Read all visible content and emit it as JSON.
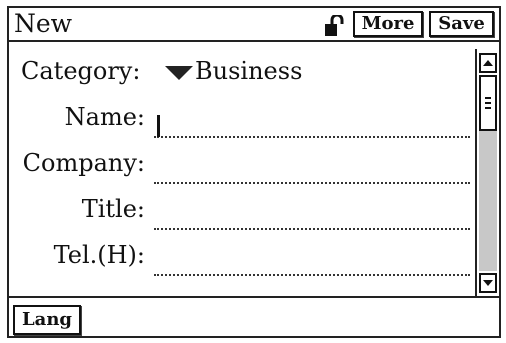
{
  "window": {
    "title": "New"
  },
  "toolbar": {
    "lock_icon": "unlocked-padlock-icon",
    "more_label": "More",
    "save_label": "Save"
  },
  "form": {
    "category_label": "Category:",
    "category_value": "Business",
    "category_dropdown_icon": "triangle-down-icon",
    "fields": [
      {
        "label": "Name:",
        "value": "",
        "focused": true
      },
      {
        "label": "Company:",
        "value": ""
      },
      {
        "label": "Title:",
        "value": ""
      },
      {
        "label": "Tel.(H):",
        "value": ""
      }
    ]
  },
  "scrollbar": {
    "up_icon": "arrow-up-icon",
    "down_icon": "arrow-down-icon",
    "position": 0
  },
  "bottom": {
    "lang_label": "Lang"
  }
}
